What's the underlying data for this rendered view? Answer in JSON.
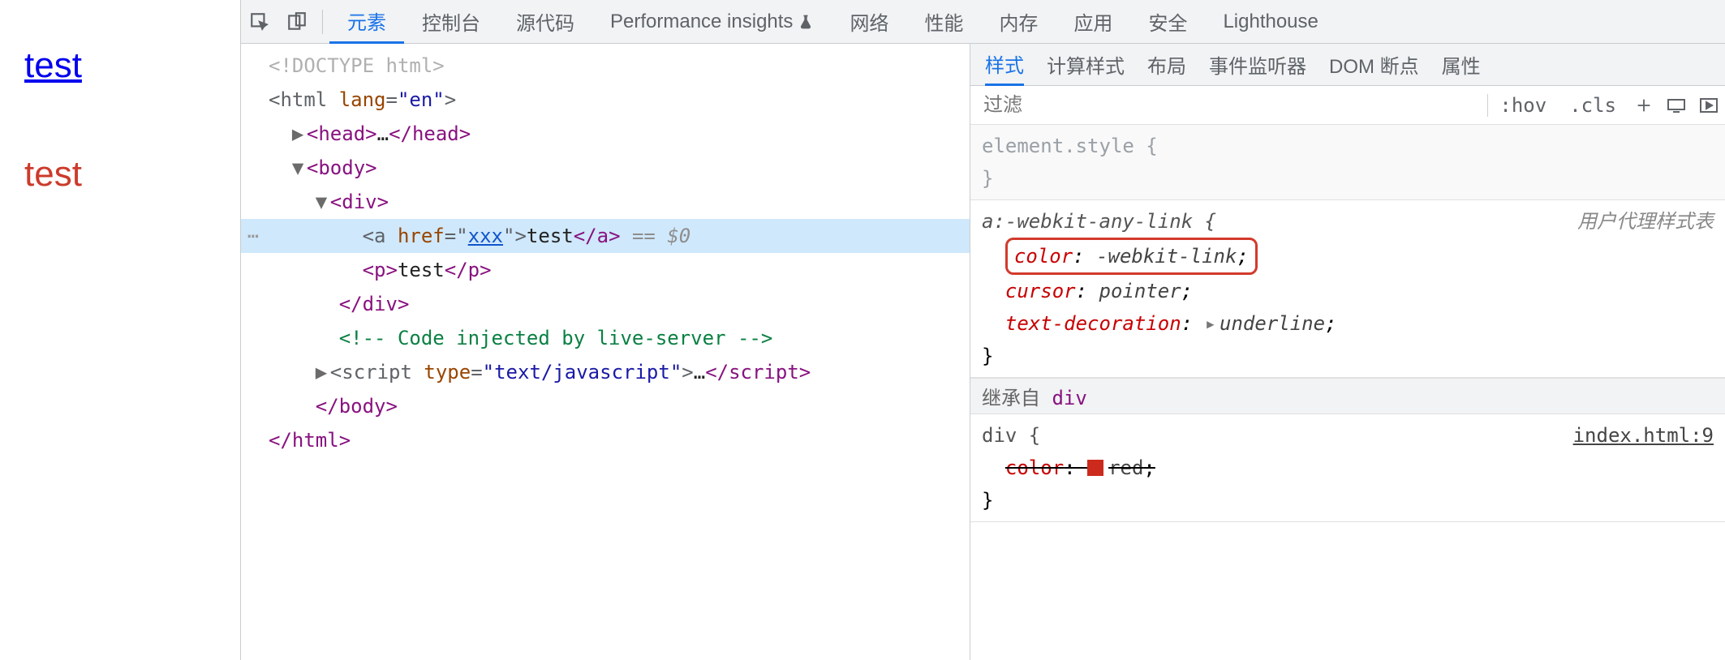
{
  "page": {
    "link_text": "test",
    "para_text": "test"
  },
  "toolbar": {
    "tabs": {
      "elements": "元素",
      "console": "控制台",
      "sources": "源代码",
      "perf_insights": "Performance insights",
      "network": "网络",
      "performance": "性能",
      "memory": "内存",
      "application": "应用",
      "security": "安全",
      "lighthouse": "Lighthouse"
    }
  },
  "elements_tree": {
    "doctype": "<!DOCTYPE html>",
    "html_open_pre": "<html ",
    "html_lang_name": "lang",
    "html_lang_val": "\"en\"",
    "html_open_post": ">",
    "head_open": "<head>",
    "head_ellipsis": "…",
    "head_close": "</head>",
    "body_open": "<body>",
    "div_open": "<div>",
    "a_open_pre": "<a ",
    "a_href_name": "href",
    "a_href_eq": "=\"",
    "a_href_val": "xxx",
    "a_href_post": "\">",
    "a_text": "test",
    "a_close": "</a>",
    "sel_hint": " == $0",
    "p_open": "<p>",
    "p_text": "test",
    "p_close": "</p>",
    "div_close": "</div>",
    "comment": "<!-- Code injected by live-server -->",
    "script_open_pre": "<script ",
    "script_type_name": "type",
    "script_type_val": "\"text/javascript\"",
    "script_open_post": ">",
    "script_ellipsis": "…",
    "script_close_tag": "</script>",
    "body_close": "</body>",
    "html_close": "</html>"
  },
  "styles": {
    "subtabs": {
      "styles": "样式",
      "computed": "计算样式",
      "layout": "布局",
      "listeners": "事件监听器",
      "dom_bp": "DOM 断点",
      "props": "属性"
    },
    "filter_placeholder": "过滤",
    "hov": ":hov",
    "cls": ".cls",
    "element_style_label": "element.style {",
    "brace_close": "}",
    "rule_ua": {
      "selector": "a:-webkit-any-link {",
      "ua_label": "用户代理样式表",
      "p1_name": "color",
      "p1_val": "-webkit-link",
      "p2_name": "cursor",
      "p2_val": "pointer",
      "p3_name": "text-decoration",
      "p3_val": "underline"
    },
    "inherit_label": "继承自 ",
    "inherit_el": "div",
    "rule_div": {
      "selector": "div {",
      "source": "index.html:9",
      "p1_name": "color",
      "p1_val": "red"
    }
  }
}
